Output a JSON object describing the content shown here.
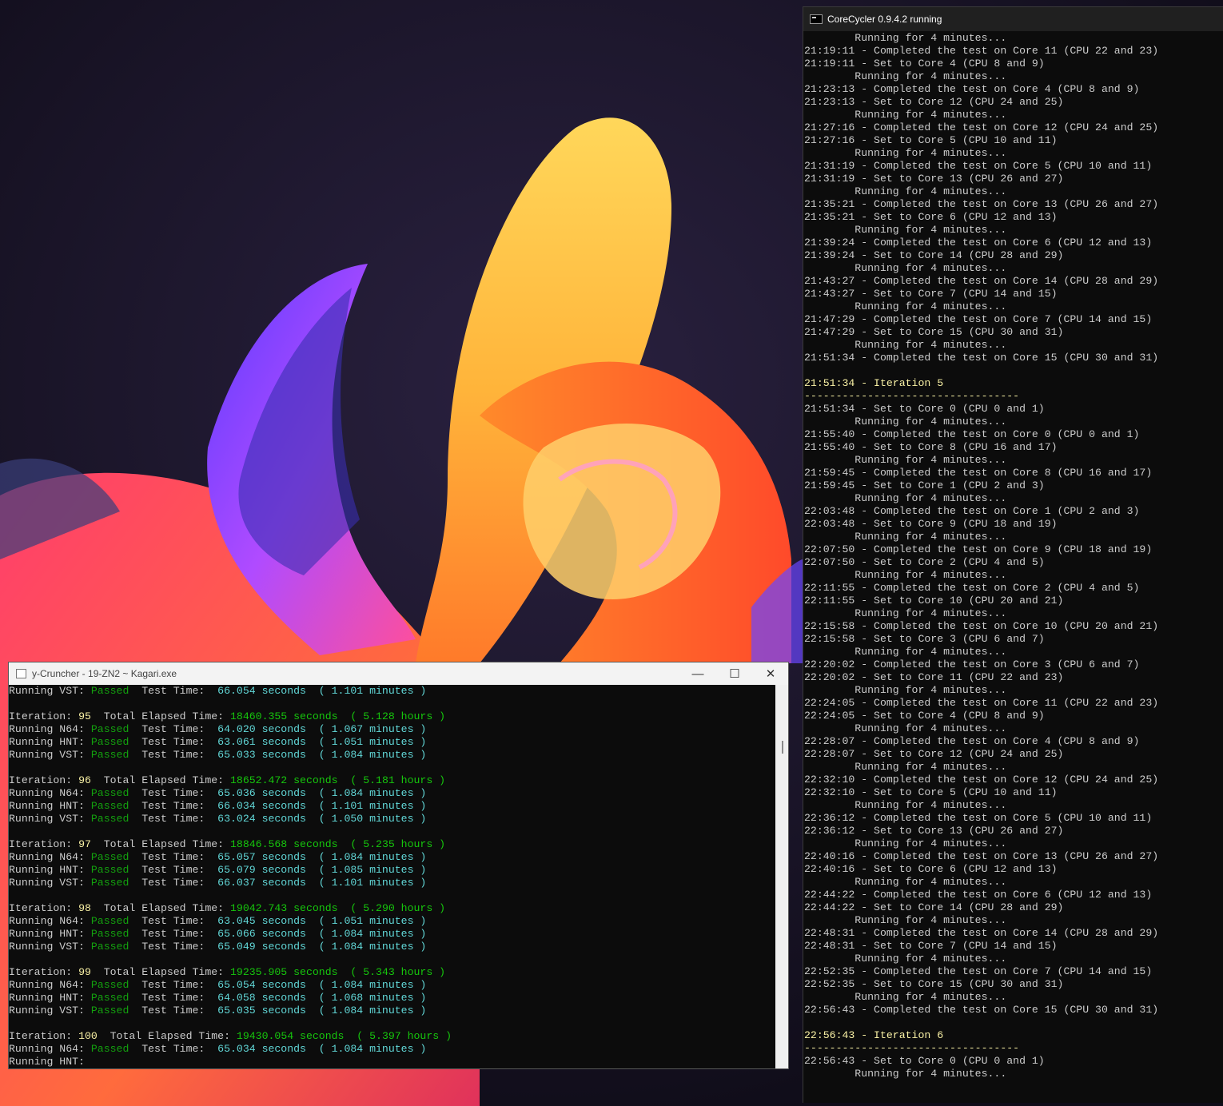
{
  "colors": {
    "terminal_bg": "#0c0c0c",
    "text": "#cccccc",
    "highlight": "#f9f1a5",
    "passed": "#13a10e",
    "seconds": "#61d6d6",
    "elapsed": "#16c60c"
  },
  "corecycler": {
    "title": "CoreCycler 0.9.4.2 running",
    "icon": "console-icon",
    "lines": [
      {
        "t": "        Running for 4 minutes..."
      },
      {
        "t": "21:19:11 - Completed the test on Core 11 (CPU 22 and 23)"
      },
      {
        "t": "21:19:11 - Set to Core 4 (CPU 8 and 9)"
      },
      {
        "t": "        Running for 4 minutes..."
      },
      {
        "t": "21:23:13 - Completed the test on Core 4 (CPU 8 and 9)"
      },
      {
        "t": "21:23:13 - Set to Core 12 (CPU 24 and 25)"
      },
      {
        "t": "        Running for 4 minutes..."
      },
      {
        "t": "21:27:16 - Completed the test on Core 12 (CPU 24 and 25)"
      },
      {
        "t": "21:27:16 - Set to Core 5 (CPU 10 and 11)"
      },
      {
        "t": "        Running for 4 minutes..."
      },
      {
        "t": "21:31:19 - Completed the test on Core 5 (CPU 10 and 11)"
      },
      {
        "t": "21:31:19 - Set to Core 13 (CPU 26 and 27)"
      },
      {
        "t": "        Running for 4 minutes..."
      },
      {
        "t": "21:35:21 - Completed the test on Core 13 (CPU 26 and 27)"
      },
      {
        "t": "21:35:21 - Set to Core 6 (CPU 12 and 13)"
      },
      {
        "t": "        Running for 4 minutes..."
      },
      {
        "t": "21:39:24 - Completed the test on Core 6 (CPU 12 and 13)"
      },
      {
        "t": "21:39:24 - Set to Core 14 (CPU 28 and 29)"
      },
      {
        "t": "        Running for 4 minutes..."
      },
      {
        "t": "21:43:27 - Completed the test on Core 14 (CPU 28 and 29)"
      },
      {
        "t": "21:43:27 - Set to Core 7 (CPU 14 and 15)"
      },
      {
        "t": "        Running for 4 minutes..."
      },
      {
        "t": "21:47:29 - Completed the test on Core 7 (CPU 14 and 15)"
      },
      {
        "t": "21:47:29 - Set to Core 15 (CPU 30 and 31)"
      },
      {
        "t": "        Running for 4 minutes..."
      },
      {
        "t": "21:51:34 - Completed the test on Core 15 (CPU 30 and 31)"
      },
      {
        "t": ""
      },
      {
        "t": "21:51:34 - Iteration 5",
        "hl": true
      },
      {
        "t": "----------------------------------",
        "hl": true
      },
      {
        "t": "21:51:34 - Set to Core 0 (CPU 0 and 1)"
      },
      {
        "t": "        Running for 4 minutes..."
      },
      {
        "t": "21:55:40 - Completed the test on Core 0 (CPU 0 and 1)"
      },
      {
        "t": "21:55:40 - Set to Core 8 (CPU 16 and 17)"
      },
      {
        "t": "        Running for 4 minutes..."
      },
      {
        "t": "21:59:45 - Completed the test on Core 8 (CPU 16 and 17)"
      },
      {
        "t": "21:59:45 - Set to Core 1 (CPU 2 and 3)"
      },
      {
        "t": "        Running for 4 minutes..."
      },
      {
        "t": "22:03:48 - Completed the test on Core 1 (CPU 2 and 3)"
      },
      {
        "t": "22:03:48 - Set to Core 9 (CPU 18 and 19)"
      },
      {
        "t": "        Running for 4 minutes..."
      },
      {
        "t": "22:07:50 - Completed the test on Core 9 (CPU 18 and 19)"
      },
      {
        "t": "22:07:50 - Set to Core 2 (CPU 4 and 5)"
      },
      {
        "t": "        Running for 4 minutes..."
      },
      {
        "t": "22:11:55 - Completed the test on Core 2 (CPU 4 and 5)"
      },
      {
        "t": "22:11:55 - Set to Core 10 (CPU 20 and 21)"
      },
      {
        "t": "        Running for 4 minutes..."
      },
      {
        "t": "22:15:58 - Completed the test on Core 10 (CPU 20 and 21)"
      },
      {
        "t": "22:15:58 - Set to Core 3 (CPU 6 and 7)"
      },
      {
        "t": "        Running for 4 minutes..."
      },
      {
        "t": "22:20:02 - Completed the test on Core 3 (CPU 6 and 7)"
      },
      {
        "t": "22:20:02 - Set to Core 11 (CPU 22 and 23)"
      },
      {
        "t": "        Running for 4 minutes..."
      },
      {
        "t": "22:24:05 - Completed the test on Core 11 (CPU 22 and 23)"
      },
      {
        "t": "22:24:05 - Set to Core 4 (CPU 8 and 9)"
      },
      {
        "t": "        Running for 4 minutes..."
      },
      {
        "t": "22:28:07 - Completed the test on Core 4 (CPU 8 and 9)"
      },
      {
        "t": "22:28:07 - Set to Core 12 (CPU 24 and 25)"
      },
      {
        "t": "        Running for 4 minutes..."
      },
      {
        "t": "22:32:10 - Completed the test on Core 12 (CPU 24 and 25)"
      },
      {
        "t": "22:32:10 - Set to Core 5 (CPU 10 and 11)"
      },
      {
        "t": "        Running for 4 minutes..."
      },
      {
        "t": "22:36:12 - Completed the test on Core 5 (CPU 10 and 11)"
      },
      {
        "t": "22:36:12 - Set to Core 13 (CPU 26 and 27)"
      },
      {
        "t": "        Running for 4 minutes..."
      },
      {
        "t": "22:40:16 - Completed the test on Core 13 (CPU 26 and 27)"
      },
      {
        "t": "22:40:16 - Set to Core 6 (CPU 12 and 13)"
      },
      {
        "t": "        Running for 4 minutes..."
      },
      {
        "t": "22:44:22 - Completed the test on Core 6 (CPU 12 and 13)"
      },
      {
        "t": "22:44:22 - Set to Core 14 (CPU 28 and 29)"
      },
      {
        "t": "        Running for 4 minutes..."
      },
      {
        "t": "22:48:31 - Completed the test on Core 14 (CPU 28 and 29)"
      },
      {
        "t": "22:48:31 - Set to Core 7 (CPU 14 and 15)"
      },
      {
        "t": "        Running for 4 minutes..."
      },
      {
        "t": "22:52:35 - Completed the test on Core 7 (CPU 14 and 15)"
      },
      {
        "t": "22:52:35 - Set to Core 15 (CPU 30 and 31)"
      },
      {
        "t": "        Running for 4 minutes..."
      },
      {
        "t": "22:56:43 - Completed the test on Core 15 (CPU 30 and 31)"
      },
      {
        "t": ""
      },
      {
        "t": "22:56:43 - Iteration 6",
        "hl": true
      },
      {
        "t": "----------------------------------",
        "hl": true
      },
      {
        "t": "22:56:43 - Set to Core 0 (CPU 0 and 1)"
      },
      {
        "t": "        Running for 4 minutes..."
      }
    ]
  },
  "ycruncher": {
    "title": "y-Cruncher - 19-ZN2 ~ Kagari.exe",
    "icon": "window-icon",
    "controls": {
      "minimize": "—",
      "maximize": "☐",
      "close": "✕"
    },
    "lines": [
      [
        {
          "t": "Running VST: ",
          "c": "lbl"
        },
        {
          "t": "Passed",
          "c": "pass"
        },
        {
          "t": "  Test Time:  ",
          "c": "lbl"
        },
        {
          "t": "66.054 seconds",
          "c": "sec"
        },
        {
          "t": "  ( 1.101 minutes )",
          "c": "sec"
        }
      ],
      [],
      [
        {
          "t": "Iteration: ",
          "c": "lbl"
        },
        {
          "t": "95",
          "c": "num"
        },
        {
          "t": "  Total Elapsed Time: ",
          "c": "lbl"
        },
        {
          "t": "18460.355 seconds",
          "c": "elap"
        },
        {
          "t": "  ( 5.128 hours )",
          "c": "elap"
        }
      ],
      [
        {
          "t": "Running N64: ",
          "c": "lbl"
        },
        {
          "t": "Passed",
          "c": "pass"
        },
        {
          "t": "  Test Time:  ",
          "c": "lbl"
        },
        {
          "t": "64.020 seconds",
          "c": "sec"
        },
        {
          "t": "  ( 1.067 minutes )",
          "c": "sec"
        }
      ],
      [
        {
          "t": "Running HNT: ",
          "c": "lbl"
        },
        {
          "t": "Passed",
          "c": "pass"
        },
        {
          "t": "  Test Time:  ",
          "c": "lbl"
        },
        {
          "t": "63.061 seconds",
          "c": "sec"
        },
        {
          "t": "  ( 1.051 minutes )",
          "c": "sec"
        }
      ],
      [
        {
          "t": "Running VST: ",
          "c": "lbl"
        },
        {
          "t": "Passed",
          "c": "pass"
        },
        {
          "t": "  Test Time:  ",
          "c": "lbl"
        },
        {
          "t": "65.033 seconds",
          "c": "sec"
        },
        {
          "t": "  ( 1.084 minutes )",
          "c": "sec"
        }
      ],
      [],
      [
        {
          "t": "Iteration: ",
          "c": "lbl"
        },
        {
          "t": "96",
          "c": "num"
        },
        {
          "t": "  Total Elapsed Time: ",
          "c": "lbl"
        },
        {
          "t": "18652.472 seconds",
          "c": "elap"
        },
        {
          "t": "  ( 5.181 hours )",
          "c": "elap"
        }
      ],
      [
        {
          "t": "Running N64: ",
          "c": "lbl"
        },
        {
          "t": "Passed",
          "c": "pass"
        },
        {
          "t": "  Test Time:  ",
          "c": "lbl"
        },
        {
          "t": "65.036 seconds",
          "c": "sec"
        },
        {
          "t": "  ( 1.084 minutes )",
          "c": "sec"
        }
      ],
      [
        {
          "t": "Running HNT: ",
          "c": "lbl"
        },
        {
          "t": "Passed",
          "c": "pass"
        },
        {
          "t": "  Test Time:  ",
          "c": "lbl"
        },
        {
          "t": "66.034 seconds",
          "c": "sec"
        },
        {
          "t": "  ( 1.101 minutes )",
          "c": "sec"
        }
      ],
      [
        {
          "t": "Running VST: ",
          "c": "lbl"
        },
        {
          "t": "Passed",
          "c": "pass"
        },
        {
          "t": "  Test Time:  ",
          "c": "lbl"
        },
        {
          "t": "63.024 seconds",
          "c": "sec"
        },
        {
          "t": "  ( 1.050 minutes )",
          "c": "sec"
        }
      ],
      [],
      [
        {
          "t": "Iteration: ",
          "c": "lbl"
        },
        {
          "t": "97",
          "c": "num"
        },
        {
          "t": "  Total Elapsed Time: ",
          "c": "lbl"
        },
        {
          "t": "18846.568 seconds",
          "c": "elap"
        },
        {
          "t": "  ( 5.235 hours )",
          "c": "elap"
        }
      ],
      [
        {
          "t": "Running N64: ",
          "c": "lbl"
        },
        {
          "t": "Passed",
          "c": "pass"
        },
        {
          "t": "  Test Time:  ",
          "c": "lbl"
        },
        {
          "t": "65.057 seconds",
          "c": "sec"
        },
        {
          "t": "  ( 1.084 minutes )",
          "c": "sec"
        }
      ],
      [
        {
          "t": "Running HNT: ",
          "c": "lbl"
        },
        {
          "t": "Passed",
          "c": "pass"
        },
        {
          "t": "  Test Time:  ",
          "c": "lbl"
        },
        {
          "t": "65.079 seconds",
          "c": "sec"
        },
        {
          "t": "  ( 1.085 minutes )",
          "c": "sec"
        }
      ],
      [
        {
          "t": "Running VST: ",
          "c": "lbl"
        },
        {
          "t": "Passed",
          "c": "pass"
        },
        {
          "t": "  Test Time:  ",
          "c": "lbl"
        },
        {
          "t": "66.037 seconds",
          "c": "sec"
        },
        {
          "t": "  ( 1.101 minutes )",
          "c": "sec"
        }
      ],
      [],
      [
        {
          "t": "Iteration: ",
          "c": "lbl"
        },
        {
          "t": "98",
          "c": "num"
        },
        {
          "t": "  Total Elapsed Time: ",
          "c": "lbl"
        },
        {
          "t": "19042.743 seconds",
          "c": "elap"
        },
        {
          "t": "  ( 5.290 hours )",
          "c": "elap"
        }
      ],
      [
        {
          "t": "Running N64: ",
          "c": "lbl"
        },
        {
          "t": "Passed",
          "c": "pass"
        },
        {
          "t": "  Test Time:  ",
          "c": "lbl"
        },
        {
          "t": "63.045 seconds",
          "c": "sec"
        },
        {
          "t": "  ( 1.051 minutes )",
          "c": "sec"
        }
      ],
      [
        {
          "t": "Running HNT: ",
          "c": "lbl"
        },
        {
          "t": "Passed",
          "c": "pass"
        },
        {
          "t": "  Test Time:  ",
          "c": "lbl"
        },
        {
          "t": "65.066 seconds",
          "c": "sec"
        },
        {
          "t": "  ( 1.084 minutes )",
          "c": "sec"
        }
      ],
      [
        {
          "t": "Running VST: ",
          "c": "lbl"
        },
        {
          "t": "Passed",
          "c": "pass"
        },
        {
          "t": "  Test Time:  ",
          "c": "lbl"
        },
        {
          "t": "65.049 seconds",
          "c": "sec"
        },
        {
          "t": "  ( 1.084 minutes )",
          "c": "sec"
        }
      ],
      [],
      [
        {
          "t": "Iteration: ",
          "c": "lbl"
        },
        {
          "t": "99",
          "c": "num"
        },
        {
          "t": "  Total Elapsed Time: ",
          "c": "lbl"
        },
        {
          "t": "19235.905 seconds",
          "c": "elap"
        },
        {
          "t": "  ( 5.343 hours )",
          "c": "elap"
        }
      ],
      [
        {
          "t": "Running N64: ",
          "c": "lbl"
        },
        {
          "t": "Passed",
          "c": "pass"
        },
        {
          "t": "  Test Time:  ",
          "c": "lbl"
        },
        {
          "t": "65.054 seconds",
          "c": "sec"
        },
        {
          "t": "  ( 1.084 minutes )",
          "c": "sec"
        }
      ],
      [
        {
          "t": "Running HNT: ",
          "c": "lbl"
        },
        {
          "t": "Passed",
          "c": "pass"
        },
        {
          "t": "  Test Time:  ",
          "c": "lbl"
        },
        {
          "t": "64.058 seconds",
          "c": "sec"
        },
        {
          "t": "  ( 1.068 minutes )",
          "c": "sec"
        }
      ],
      [
        {
          "t": "Running VST: ",
          "c": "lbl"
        },
        {
          "t": "Passed",
          "c": "pass"
        },
        {
          "t": "  Test Time:  ",
          "c": "lbl"
        },
        {
          "t": "65.035 seconds",
          "c": "sec"
        },
        {
          "t": "  ( 1.084 minutes )",
          "c": "sec"
        }
      ],
      [],
      [
        {
          "t": "Iteration: ",
          "c": "lbl"
        },
        {
          "t": "100",
          "c": "num"
        },
        {
          "t": "  Total Elapsed Time: ",
          "c": "lbl"
        },
        {
          "t": "19430.054 seconds",
          "c": "elap"
        },
        {
          "t": "  ( 5.397 hours )",
          "c": "elap"
        }
      ],
      [
        {
          "t": "Running N64: ",
          "c": "lbl"
        },
        {
          "t": "Passed",
          "c": "pass"
        },
        {
          "t": "  Test Time:  ",
          "c": "lbl"
        },
        {
          "t": "65.034 seconds",
          "c": "sec"
        },
        {
          "t": "  ( 1.084 minutes )",
          "c": "sec"
        }
      ],
      [
        {
          "t": "Running HNT:",
          "c": "lbl"
        }
      ]
    ]
  }
}
